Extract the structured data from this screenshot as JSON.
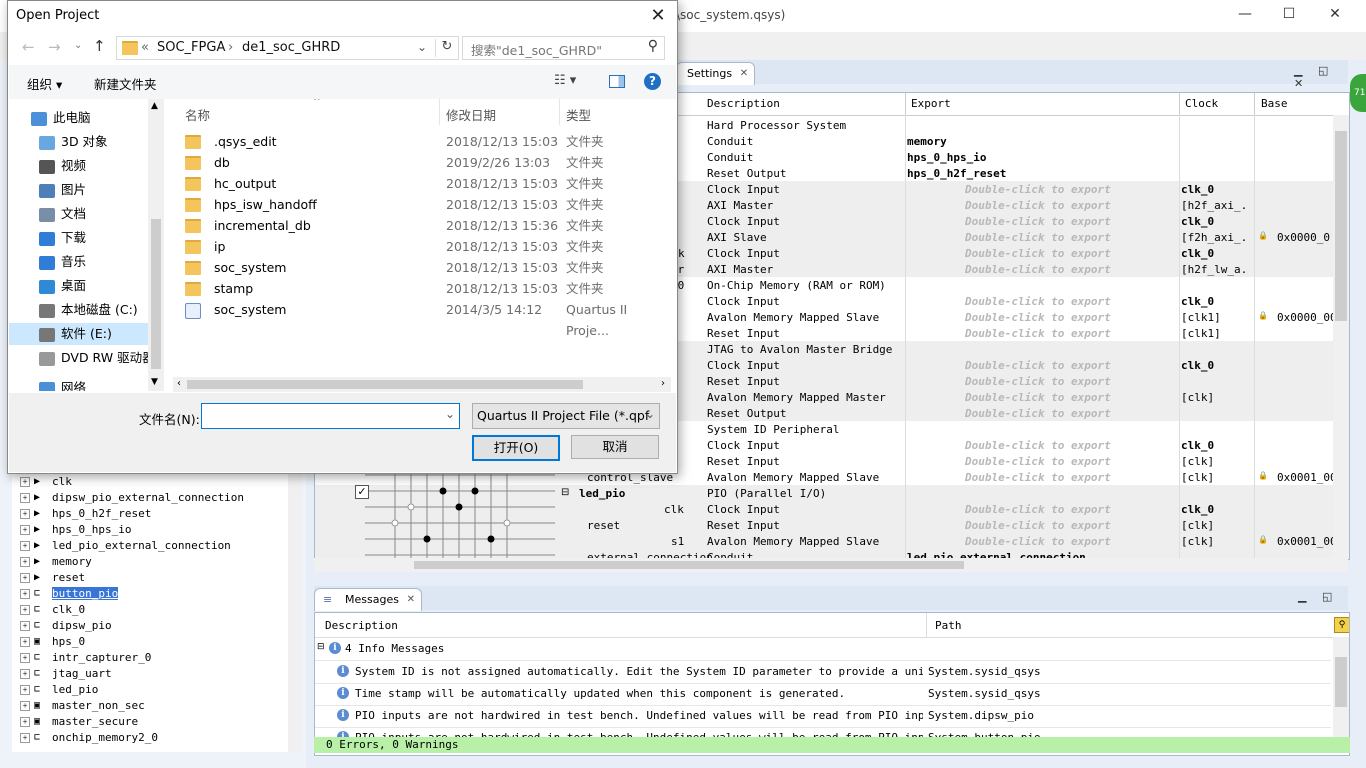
{
  "app": {
    "window_title": "\\soc_system.qsys)",
    "win_min": "—",
    "win_max": "☐",
    "win_close": "✕"
  },
  "content_tab": {
    "label": "Settings"
  },
  "system_table": {
    "headers": [
      "Description",
      "Export",
      "Clock",
      "Base"
    ],
    "double_click": "Double-click to export",
    "rows": [
      {
        "desc": "Hard Processor System",
        "export": "",
        "clock": "",
        "base": "",
        "dbl": false,
        "shade": false
      },
      {
        "desc": "Conduit",
        "export": "memory",
        "clock": "",
        "base": "",
        "dbl": false,
        "shade": false
      },
      {
        "desc": "Conduit",
        "export": "hps_0_hps_io",
        "clock": "",
        "base": "",
        "dbl": false,
        "shade": false
      },
      {
        "desc": "Reset Output",
        "export": "hps_0_h2f_reset",
        "clock": "",
        "base": "",
        "dbl": false,
        "shade": false
      },
      {
        "desc": "Clock Input",
        "export": "",
        "clock": "clk_0",
        "base": "",
        "dbl": true,
        "shade": true
      },
      {
        "desc": "AXI Master",
        "export": "",
        "clock": "[h2f_axi_...",
        "base": "",
        "dbl": true,
        "shade": true
      },
      {
        "desc": "Clock Input",
        "export": "",
        "clock": "clk_0",
        "base": "",
        "dbl": true,
        "shade": true
      },
      {
        "desc": "AXI Slave",
        "export": "",
        "clock": "[f2h_axi_...",
        "base": "0x0000_0",
        "dbl": true,
        "shade": true
      },
      {
        "desc": "Clock Input",
        "export": "",
        "clock": "clk_0",
        "base": "",
        "dbl": true,
        "shade": true
      },
      {
        "desc": "AXI Master",
        "export": "",
        "clock": "[h2f_lw_a...",
        "base": "",
        "dbl": true,
        "shade": true
      },
      {
        "desc": "On-Chip Memory (RAM or ROM)",
        "export": "",
        "clock": "",
        "base": "",
        "dbl": false,
        "shade": false
      },
      {
        "desc": "Clock Input",
        "export": "",
        "clock": "clk_0",
        "base": "",
        "dbl": true,
        "shade": false
      },
      {
        "desc": "Avalon Memory Mapped Slave",
        "export": "",
        "clock": "[clk1]",
        "base": "0x0000_00",
        "dbl": true,
        "shade": false
      },
      {
        "desc": "Reset Input",
        "export": "",
        "clock": "[clk1]",
        "base": "",
        "dbl": true,
        "shade": false
      },
      {
        "desc": "JTAG to Avalon Master Bridge",
        "export": "",
        "clock": "",
        "base": "",
        "dbl": false,
        "shade": true
      },
      {
        "desc": "Clock Input",
        "export": "",
        "clock": "clk_0",
        "base": "",
        "dbl": true,
        "shade": true
      },
      {
        "desc": "Reset Input",
        "export": "",
        "clock": "",
        "base": "",
        "dbl": true,
        "shade": true
      },
      {
        "desc": "Avalon Memory Mapped Master",
        "export": "",
        "clock": "[clk]",
        "base": "",
        "dbl": true,
        "shade": true
      },
      {
        "desc": "Reset Output",
        "export": "",
        "clock": "",
        "base": "",
        "dbl": true,
        "shade": true
      },
      {
        "desc": "System ID Peripheral",
        "export": "",
        "clock": "",
        "base": "",
        "dbl": false,
        "shade": false
      },
      {
        "desc": "Clock Input",
        "export": "",
        "clock": "clk_0",
        "base": "",
        "dbl": true,
        "shade": false
      },
      {
        "desc": "Reset Input",
        "export": "",
        "clock": "[clk]",
        "base": "",
        "dbl": true,
        "shade": false
      },
      {
        "desc": "Avalon Memory Mapped Slave",
        "export": "",
        "clock": "[clk]",
        "base": "0x0001_00",
        "dbl": true,
        "shade": false
      },
      {
        "desc": "PIO (Parallel I/O)",
        "export": "",
        "clock": "",
        "base": "",
        "dbl": false,
        "shade": true
      },
      {
        "desc": "Clock Input",
        "export": "",
        "clock": "clk_0",
        "base": "",
        "dbl": true,
        "shade": true
      },
      {
        "desc": "Reset Input",
        "export": "",
        "clock": "[clk]",
        "base": "",
        "dbl": true,
        "shade": true
      },
      {
        "desc": "Avalon Memory Mapped Slave",
        "export": "",
        "clock": "[clk]",
        "base": "0x0001_00",
        "dbl": true,
        "shade": true
      },
      {
        "desc": "Conduit",
        "export": "led_pio_external_connection",
        "clock": "",
        "base": "",
        "dbl": false,
        "shade": true
      }
    ],
    "left_names": [
      {
        "text": "k",
        "row": 8
      },
      {
        "text": "er",
        "row": 9
      },
      {
        "text": "_0",
        "row": 10
      },
      {
        "text": "control_slave",
        "row": 22
      },
      {
        "text": "led_pio",
        "row": 23,
        "bold": true,
        "expander": "⊟"
      },
      {
        "text": "clk",
        "row": 24
      },
      {
        "text": "reset",
        "row": 25
      },
      {
        "text": "s1",
        "row": 26
      },
      {
        "text": "external_connection",
        "row": 27
      }
    ]
  },
  "messages": {
    "tab": "Messages",
    "col_desc": "Description",
    "col_path": "Path",
    "group": "4 Info Messages",
    "items": [
      {
        "text": "System ID is not assigned automatically. Edit the System ID parameter to provide a unique ID",
        "path": "System.sysid_qsys"
      },
      {
        "text": "Time stamp will be automatically updated when this component is generated.",
        "path": "System.sysid_qsys"
      },
      {
        "text": "PIO inputs are not hardwired in test bench. Undefined values will be read from PIO inputs during simulation.",
        "path": "System.dipsw_pio"
      },
      {
        "text": "PIO inputs are not hardwired in test bench. Undefined values will be read from PIO inputs during simulation.",
        "path": "System.button_pio"
      }
    ],
    "status": "0 Errors, 0 Warnings"
  },
  "hierarchy": {
    "items": [
      {
        "label": "clk",
        "icon": "▶",
        "selected": false
      },
      {
        "label": "dipsw_pio_external_connection",
        "icon": "▶",
        "selected": false
      },
      {
        "label": "hps_0_h2f_reset",
        "icon": "▶",
        "selected": false
      },
      {
        "label": "hps_0_hps_io",
        "icon": "▶",
        "selected": false
      },
      {
        "label": "led_pio_external_connection",
        "icon": "▶",
        "selected": false
      },
      {
        "label": "memory",
        "icon": "▶",
        "selected": false
      },
      {
        "label": "reset",
        "icon": "▶",
        "selected": false
      },
      {
        "label": "button_pio",
        "icon": "⊏",
        "selected": true
      },
      {
        "label": "clk_0",
        "icon": "⊏",
        "selected": false
      },
      {
        "label": "dipsw_pio",
        "icon": "⊏",
        "selected": false
      },
      {
        "label": "hps_0",
        "icon": "▣",
        "selected": false
      },
      {
        "label": "intr_capturer_0",
        "icon": "⊏",
        "selected": false
      },
      {
        "label": "jtag_uart",
        "icon": "⊏",
        "selected": false
      },
      {
        "label": "led_pio",
        "icon": "⊏",
        "selected": false
      },
      {
        "label": "master_non_sec",
        "icon": "▣",
        "selected": false
      },
      {
        "label": "master_secure",
        "icon": "▣",
        "selected": false
      },
      {
        "label": "onchip_memory2_0",
        "icon": "⊏",
        "selected": false
      }
    ]
  },
  "dialog": {
    "title": "Open Project",
    "close": "✕",
    "breadcrumb": [
      "«",
      "SOC_FPGA",
      "›",
      "de1_soc_GHRD"
    ],
    "search_placeholder": "搜索\"de1_soc_GHRD\"",
    "toolbar": {
      "organize": "组织 ▾",
      "new_folder": "新建文件夹"
    },
    "nav": [
      {
        "label": "此电脑",
        "color": "#4a90d9"
      },
      {
        "label": "3D 对象",
        "color": "#6aa7e0"
      },
      {
        "label": "视频",
        "color": "#555"
      },
      {
        "label": "图片",
        "color": "#4f7fb8"
      },
      {
        "label": "文档",
        "color": "#7a8da6"
      },
      {
        "label": "下载",
        "color": "#2f7dd6"
      },
      {
        "label": "音乐",
        "color": "#2f7dd6"
      },
      {
        "label": "桌面",
        "color": "#2f8ad6"
      },
      {
        "label": "本地磁盘 (C:)",
        "color": "#777"
      },
      {
        "label": "软件 (E:)",
        "color": "#777"
      },
      {
        "label": "DVD RW 驱动器",
        "color": "#999"
      },
      {
        "label": "网络",
        "color": "#4a90d9"
      }
    ],
    "columns": {
      "name": "名称",
      "date": "修改日期",
      "type": "类型"
    },
    "files": [
      {
        "name": ".qsys_edit",
        "date": "2018/12/13 15:03",
        "type": "文件夹",
        "kind": "folder"
      },
      {
        "name": "db",
        "date": "2019/2/26 13:03",
        "type": "文件夹",
        "kind": "folder"
      },
      {
        "name": "hc_output",
        "date": "2018/12/13 15:03",
        "type": "文件夹",
        "kind": "folder"
      },
      {
        "name": "hps_isw_handoff",
        "date": "2018/12/13 15:03",
        "type": "文件夹",
        "kind": "folder"
      },
      {
        "name": "incremental_db",
        "date": "2018/12/13 15:36",
        "type": "文件夹",
        "kind": "folder"
      },
      {
        "name": "ip",
        "date": "2018/12/13 15:03",
        "type": "文件夹",
        "kind": "folder"
      },
      {
        "name": "soc_system",
        "date": "2018/12/13 15:03",
        "type": "文件夹",
        "kind": "folder"
      },
      {
        "name": "stamp",
        "date": "2018/12/13 15:03",
        "type": "文件夹",
        "kind": "folder"
      },
      {
        "name": "soc_system",
        "date": "2014/3/5 14:12",
        "type": "Quartus II Proje...",
        "kind": "file"
      }
    ],
    "filename_label": "文件名(N):",
    "filename_value": "",
    "filetype": "Quartus II Project File (*.qpf",
    "open": "打开(O)",
    "cancel": "取消"
  }
}
